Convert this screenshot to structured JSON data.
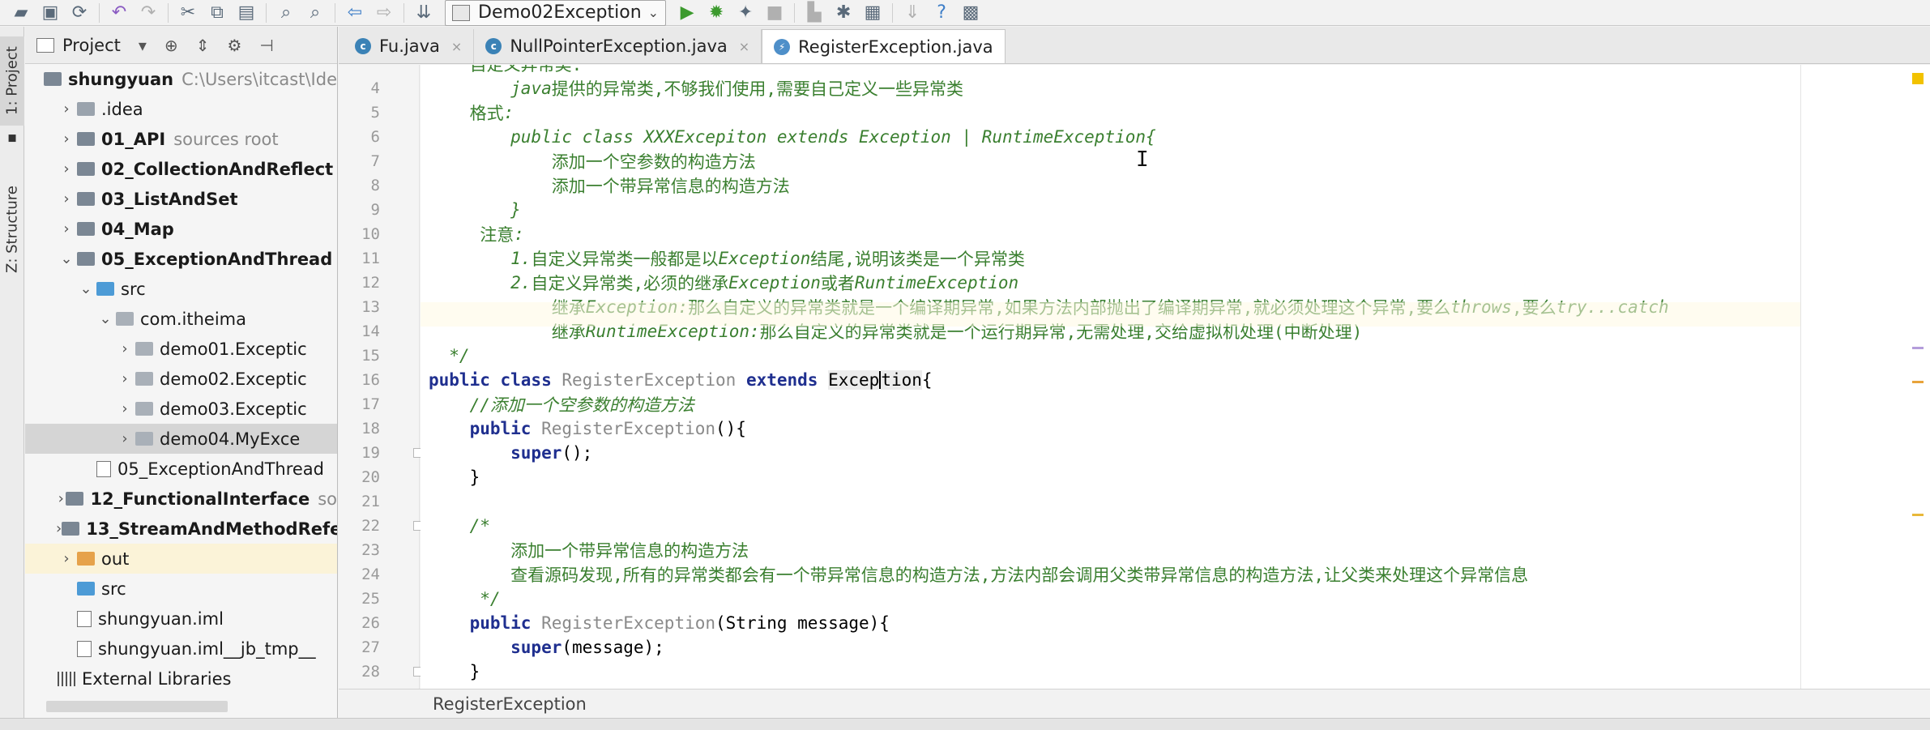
{
  "toolbar": {
    "run_config": "Demo02Exception",
    "help_glyph": "?"
  },
  "leftstrip": {
    "project_tab": "1: Project",
    "structure_tab": "Z: Structure"
  },
  "project_panel": {
    "title": "Project",
    "tree": [
      {
        "label": "shungyuan",
        "hint": "C:\\Users\\itcast\\Ide",
        "indent": 0,
        "arrow": "",
        "icon": "module",
        "bold": true
      },
      {
        "label": ".idea",
        "hint": "",
        "indent": 1,
        "arrow": "›",
        "icon": "folder",
        "bold": false
      },
      {
        "label": "01_API",
        "hint": "sources root",
        "indent": 1,
        "arrow": "›",
        "icon": "module",
        "bold": true
      },
      {
        "label": "02_CollectionAndReflect",
        "hint": "",
        "indent": 1,
        "arrow": "›",
        "icon": "module",
        "bold": true
      },
      {
        "label": "03_ListAndSet",
        "hint": "",
        "indent": 1,
        "arrow": "›",
        "icon": "module",
        "bold": true
      },
      {
        "label": "04_Map",
        "hint": "",
        "indent": 1,
        "arrow": "›",
        "icon": "module",
        "bold": true
      },
      {
        "label": "05_ExceptionAndThread",
        "hint": "",
        "indent": 1,
        "arrow": "⌄",
        "icon": "module",
        "bold": true
      },
      {
        "label": "src",
        "hint": "",
        "indent": 2,
        "arrow": "⌄",
        "icon": "blue",
        "bold": false
      },
      {
        "label": "com.itheima",
        "hint": "",
        "indent": 3,
        "arrow": "⌄",
        "icon": "pkg",
        "bold": false
      },
      {
        "label": "demo01.Exceptic",
        "hint": "",
        "indent": 4,
        "arrow": "›",
        "icon": "pkg",
        "bold": false
      },
      {
        "label": "demo02.Exceptic",
        "hint": "",
        "indent": 4,
        "arrow": "›",
        "icon": "pkg",
        "bold": false
      },
      {
        "label": "demo03.Exceptic",
        "hint": "",
        "indent": 4,
        "arrow": "›",
        "icon": "pkg",
        "bold": false
      },
      {
        "label": "demo04.MyExce",
        "hint": "",
        "indent": 4,
        "arrow": "›",
        "icon": "pkg",
        "bold": false,
        "selected": true
      },
      {
        "label": "05_ExceptionAndThread",
        "hint": "",
        "indent": 2,
        "arrow": "",
        "icon": "iml",
        "bold": false
      },
      {
        "label": "12_FunctionalInterface",
        "hint": "so",
        "indent": 1,
        "arrow": "›",
        "icon": "module",
        "bold": true
      },
      {
        "label": "13_StreamAndMethodRefe",
        "hint": "",
        "indent": 1,
        "arrow": "›",
        "icon": "module",
        "bold": true
      },
      {
        "label": "out",
        "hint": "",
        "indent": 1,
        "arrow": "›",
        "icon": "orange",
        "bold": false,
        "out": true
      },
      {
        "label": "src",
        "hint": "",
        "indent": 1,
        "arrow": "",
        "icon": "blue",
        "bold": false
      },
      {
        "label": "shungyuan.iml",
        "hint": "",
        "indent": 1,
        "arrow": "",
        "icon": "iml",
        "bold": false
      },
      {
        "label": "shungyuan.iml__jb_tmp__",
        "hint": "",
        "indent": 1,
        "arrow": "",
        "icon": "iml",
        "bold": false
      },
      {
        "label": "External Libraries",
        "hint": "",
        "indent": 0,
        "arrow": "",
        "icon": "lib",
        "bold": false
      }
    ]
  },
  "tabs": [
    {
      "label": "Fu.java",
      "icon": "c",
      "active": false
    },
    {
      "label": "NullPointerException.java",
      "icon": "c",
      "active": false
    },
    {
      "label": "RegisterException.java",
      "icon": "e",
      "active": true
    }
  ],
  "editor": {
    "current_line": 16,
    "lines": [
      {
        "num": "",
        "segs": [
          {
            "t": "    自定义异常类:",
            "c": "c-doc"
          }
        ]
      },
      {
        "num": "4",
        "segs": [
          {
            "t": "        ",
            "c": "c-doc"
          },
          {
            "t": "java",
            "c": "c-doci"
          },
          {
            "t": "提供的异常类,不够我们使用,需要自己定义一些异常类",
            "c": "c-doc"
          }
        ]
      },
      {
        "num": "5",
        "segs": [
          {
            "t": "    格式",
            "c": "c-doc"
          },
          {
            "t": ":",
            "c": "c-doci"
          }
        ]
      },
      {
        "num": "6",
        "segs": [
          {
            "t": "        public class XXXExcepiton extends Exception | RuntimeException{",
            "c": "c-doci"
          }
        ]
      },
      {
        "num": "7",
        "segs": [
          {
            "t": "            添加一个空参数的构造方法",
            "c": "c-doc"
          }
        ]
      },
      {
        "num": "8",
        "segs": [
          {
            "t": "            添加一个带异常信息的构造方法",
            "c": "c-doc"
          }
        ]
      },
      {
        "num": "9",
        "segs": [
          {
            "t": "        }",
            "c": "c-doci"
          }
        ]
      },
      {
        "num": "10",
        "segs": [
          {
            "t": "     注意",
            "c": "c-doc"
          },
          {
            "t": ":",
            "c": "c-doci"
          }
        ]
      },
      {
        "num": "11",
        "segs": [
          {
            "t": "        ",
            "c": "c-doc"
          },
          {
            "t": "1.",
            "c": "c-doci"
          },
          {
            "t": "自定义异常类一般都是以",
            "c": "c-doc"
          },
          {
            "t": "Exception",
            "c": "c-doci"
          },
          {
            "t": "结尾,说明该类是一个异常类",
            "c": "c-doc"
          }
        ]
      },
      {
        "num": "12",
        "segs": [
          {
            "t": "        ",
            "c": "c-doc"
          },
          {
            "t": "2.",
            "c": "c-doci"
          },
          {
            "t": "自定义异常类,必须的继承",
            "c": "c-doc"
          },
          {
            "t": "Exception",
            "c": "c-doci"
          },
          {
            "t": "或者",
            "c": "c-doc"
          },
          {
            "t": "RuntimeException",
            "c": "c-doci"
          }
        ]
      },
      {
        "num": "13",
        "segs": [
          {
            "t": "            继承",
            "c": "c-doc"
          },
          {
            "t": "Exception:",
            "c": "c-doci"
          },
          {
            "t": "那么自定义的异常类就是一个编译期异常,如果方法内部抛出了编译期异常,就必须处理这个异常,要么",
            "c": "c-doc"
          },
          {
            "t": "throws",
            "c": "c-doci"
          },
          {
            "t": ",要么",
            "c": "c-doc"
          },
          {
            "t": "try...catch",
            "c": "c-doci"
          }
        ]
      },
      {
        "num": "14",
        "segs": [
          {
            "t": "            继承",
            "c": "c-doc"
          },
          {
            "t": "RuntimeException:",
            "c": "c-doci"
          },
          {
            "t": "那么自定义的异常类就是一个运行期异常,无需处理,交给虚拟机处理(中断处理)",
            "c": "c-doc"
          }
        ]
      },
      {
        "num": "15",
        "segs": [
          {
            "t": "  */",
            "c": "c-doci"
          }
        ]
      },
      {
        "num": "16",
        "segs": [
          {
            "t": "public class ",
            "c": "c-kw"
          },
          {
            "t": "RegisterException ",
            "c": "c-cls"
          },
          {
            "t": "extends ",
            "c": "c-kw"
          },
          {
            "t": "Excep",
            "c": "c-plain c-hl"
          },
          {
            "t": "|",
            "c": "cursor"
          },
          {
            "t": "tion",
            "c": "c-plain c-hl"
          },
          {
            "t": "{",
            "c": "c-plain"
          }
        ]
      },
      {
        "num": "17",
        "segs": [
          {
            "t": "    //添加一个空参数的构造方法",
            "c": "c-doci"
          }
        ]
      },
      {
        "num": "18",
        "segs": [
          {
            "t": "    public ",
            "c": "c-kw"
          },
          {
            "t": "RegisterException",
            "c": "c-cls"
          },
          {
            "t": "(){",
            "c": "c-plain"
          }
        ]
      },
      {
        "num": "19",
        "segs": [
          {
            "t": "        super",
            "c": "c-kw"
          },
          {
            "t": "();",
            "c": "c-plain"
          }
        ]
      },
      {
        "num": "20",
        "segs": [
          {
            "t": "    }",
            "c": "c-plain"
          }
        ]
      },
      {
        "num": "21",
        "segs": [
          {
            "t": "",
            "c": "c-plain"
          }
        ]
      },
      {
        "num": "22",
        "segs": [
          {
            "t": "    /*",
            "c": "c-doci"
          }
        ]
      },
      {
        "num": "23",
        "segs": [
          {
            "t": "        添加一个带异常信息的构造方法",
            "c": "c-doc"
          }
        ]
      },
      {
        "num": "24",
        "segs": [
          {
            "t": "        查看源码发现,所有的异常类都会有一个带异常信息的构造方法,方法内部会调用父类带异常信息的构造方法,让父类来处理这个异常信息",
            "c": "c-doc"
          }
        ]
      },
      {
        "num": "25",
        "segs": [
          {
            "t": "     */",
            "c": "c-doci"
          }
        ]
      },
      {
        "num": "26",
        "segs": [
          {
            "t": "    public ",
            "c": "c-kw"
          },
          {
            "t": "RegisterException",
            "c": "c-cls"
          },
          {
            "t": "(String message){",
            "c": "c-plain"
          }
        ]
      },
      {
        "num": "27",
        "segs": [
          {
            "t": "        super",
            "c": "c-kw"
          },
          {
            "t": "(message);",
            "c": "c-plain"
          }
        ]
      },
      {
        "num": "28",
        "segs": [
          {
            "t": "    }",
            "c": "c-plain"
          }
        ]
      }
    ]
  },
  "breadcrumb": {
    "label": "RegisterException"
  },
  "colors": {
    "keyword": "#1f2f8f",
    "doc_comment": "#3a7f2f",
    "current_line_bg": "#fffae3",
    "error_stripe": "#f2c200"
  }
}
